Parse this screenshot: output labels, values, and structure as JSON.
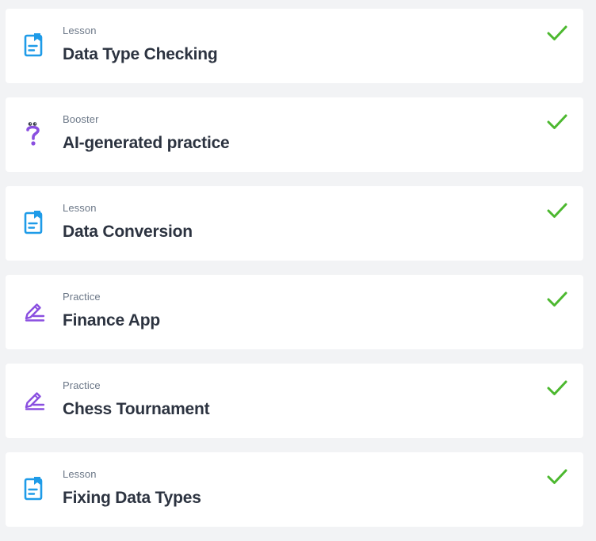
{
  "items": [
    {
      "type": "Lesson",
      "title": "Data Type Checking",
      "icon": "lesson-icon",
      "status": "completed"
    },
    {
      "type": "Booster",
      "title": "AI-generated practice",
      "icon": "booster-icon",
      "status": "completed"
    },
    {
      "type": "Lesson",
      "title": "Data Conversion",
      "icon": "lesson-icon",
      "status": "completed"
    },
    {
      "type": "Practice",
      "title": "Finance App",
      "icon": "practice-icon",
      "status": "completed"
    },
    {
      "type": "Practice",
      "title": "Chess Tournament",
      "icon": "practice-icon",
      "status": "completed"
    },
    {
      "type": "Lesson",
      "title": "Fixing Data Types",
      "icon": "lesson-icon",
      "status": "completed"
    }
  ],
  "colors": {
    "lesson_icon": "#1e9be8",
    "practice_icon": "#8a4fe0",
    "booster_icon": "#8a4fe0",
    "check": "#4cb82f",
    "background": "#f2f3f5",
    "card": "#ffffff",
    "title_text": "#2c3340",
    "type_text": "#6b7787"
  }
}
